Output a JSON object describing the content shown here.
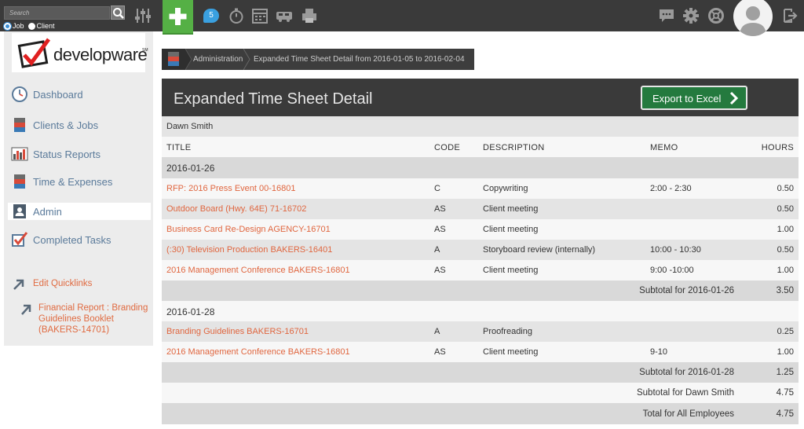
{
  "topbar": {
    "search_placeholder": "Search",
    "radio_job": "Job",
    "radio_client": "Client",
    "notification_count": "5"
  },
  "sidebar": {
    "logo_text": "developware",
    "logo_tm": "SM",
    "items": [
      {
        "label": "Dashboard",
        "icon": "clock-icon"
      },
      {
        "label": "Clients & Jobs",
        "icon": "cabinet-icon"
      },
      {
        "label": "Status Reports",
        "icon": "bar-chart-icon"
      },
      {
        "label": "Time & Expenses",
        "icon": "cabinet-icon"
      },
      {
        "label": "Admin",
        "icon": "id-badge-icon"
      },
      {
        "label": "Completed Tasks",
        "icon": "checkbox-icon"
      }
    ],
    "quicklinks": [
      {
        "label": "Edit Quicklinks"
      },
      {
        "label": "Financial Report : Branding Guidelines Booklet (BAKERS-14701)"
      }
    ]
  },
  "breadcrumb": {
    "items": [
      "Administration",
      "Expanded Time Sheet Detail from 2016-01-05 to 2016-02-04"
    ]
  },
  "panel": {
    "title": "Expanded Time Sheet Detail",
    "export_label": "Export to Excel",
    "employee": "Dawn Smith",
    "columns": [
      "TITLE",
      "CODE",
      "DESCRIPTION",
      "MEMO",
      "HOURS"
    ],
    "groups": [
      {
        "date": "2016-01-26",
        "rows": [
          {
            "title": "RFP: 2016 Press Event 00-16801",
            "code": "C",
            "description": "Copywriting",
            "memo": "2:00 - 2:30",
            "hours": "0.50"
          },
          {
            "title": "Outdoor Board (Hwy. 64E) 71-16702",
            "code": "AS",
            "description": "Client meeting",
            "memo": "",
            "hours": "0.50"
          },
          {
            "title": "Business Card Re-Design AGENCY-16701",
            "code": "AS",
            "description": "Client meeting",
            "memo": "",
            "hours": "1.00"
          },
          {
            "title": "(:30) Television Production BAKERS-16401",
            "code": "A",
            "description": "Storyboard review (internally)",
            "memo": "10:00 - 10:30",
            "hours": "0.50"
          },
          {
            "title": "2016 Management Conference BAKERS-16801",
            "code": "AS",
            "description": "Client meeting",
            "memo": "9:00 -10:00",
            "hours": "1.00"
          }
        ],
        "subtotal_label": "Subtotal for 2016-01-26",
        "subtotal": "3.50"
      },
      {
        "date": "2016-01-28",
        "rows": [
          {
            "title": "Branding Guidelines BAKERS-16701",
            "code": "A",
            "description": "Proofreading",
            "memo": "",
            "hours": "0.25"
          },
          {
            "title": "2016 Management Conference BAKERS-16801",
            "code": "AS",
            "description": "Client meeting",
            "memo": "9-10",
            "hours": "1.00"
          }
        ],
        "subtotal_label": "Subtotal for 2016-01-28",
        "subtotal": "1.25"
      }
    ],
    "employee_subtotal_label": "Subtotal for Dawn Smith",
    "employee_subtotal": "4.75",
    "total_label": "Total for All Employees",
    "total": "4.75"
  }
}
